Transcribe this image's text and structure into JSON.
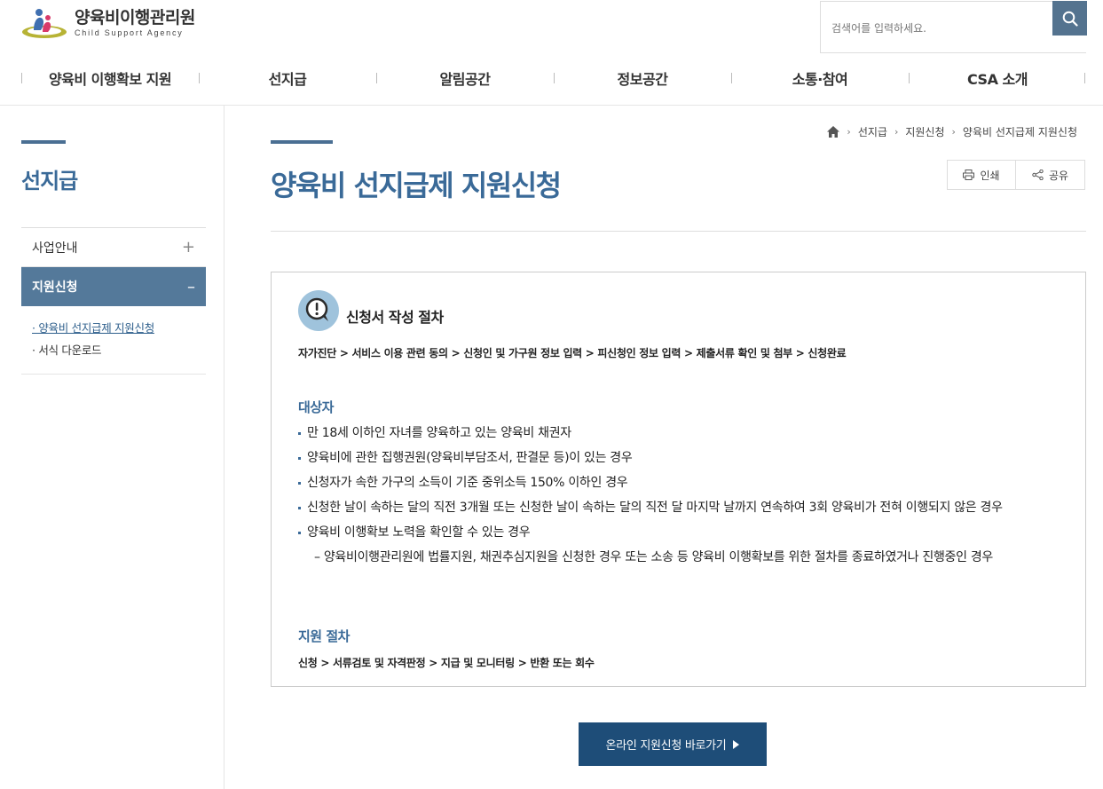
{
  "brand": {
    "name_ko": "양육비이행관리원",
    "name_en": "Child Support Agency"
  },
  "search": {
    "placeholder": "검색어를 입력하세요."
  },
  "gnb": [
    "양육비 이행확보 지원",
    "선지급",
    "알림공간",
    "정보공간",
    "소통·참여",
    "CSA 소개"
  ],
  "lnb": {
    "title": "선지급",
    "items": [
      {
        "label": "사업안내",
        "sign": "+"
      },
      {
        "label": "지원신청",
        "sign": "–"
      }
    ],
    "sub_items": [
      "· 양육비 선지급제 지원신청",
      "· 서식 다운로드"
    ]
  },
  "breadcrumb": [
    "선지급",
    "지원신청",
    "양육비 선지급제 지원신청"
  ],
  "page": {
    "title": "양육비 선지급제 지원신청",
    "print_label": "인쇄",
    "share_label": "공유"
  },
  "box": {
    "heading": "신청서 작성 절차",
    "procedure": "자가진단 > 서비스 이용 관련 동의 > 신청인 및 가구원 정보 입력 > 피신청인 정보 입력 > 제출서류 확인 및 첨부 > 신청완료",
    "target_title": "대상자",
    "targets": [
      "만 18세 이하인 자녀를 양육하고 있는 양육비 채권자",
      "양육비에 관한 집행권원(양육비부담조서, 판결문 등)이 있는 경우",
      "신청자가 속한 가구의 소득이 기준 중위소득 150% 이하인 경우",
      "신청한 날이 속하는 달의 직전 3개월 또는 신청한 날이 속하는 달의 직전 달 마지막 날까지 연속하여 3회 양육비가 전혀 이행되지 않은 경우",
      "양육비 이행확보 노력을 확인할 수 있는 경우"
    ],
    "target_sub": "– 양육비이행관리원에 법률지원, 채권추심지원을 신청한 경우 또는 소송 등 양육비 이행확보를 위한 절차를 종료하였거나 진행중인 경우",
    "support_title": "지원 절차",
    "support_procedure": "신청 > 서류검토 및 자격판정 > 지급 및 모니터링 > 반환 또는 회수"
  },
  "cta": {
    "label": "온라인 지원신청 바로가기"
  },
  "colors": {
    "primary": "#3a6a98",
    "nav_active": "#54799a",
    "button": "#1e4d78",
    "search_button": "#54738f"
  }
}
